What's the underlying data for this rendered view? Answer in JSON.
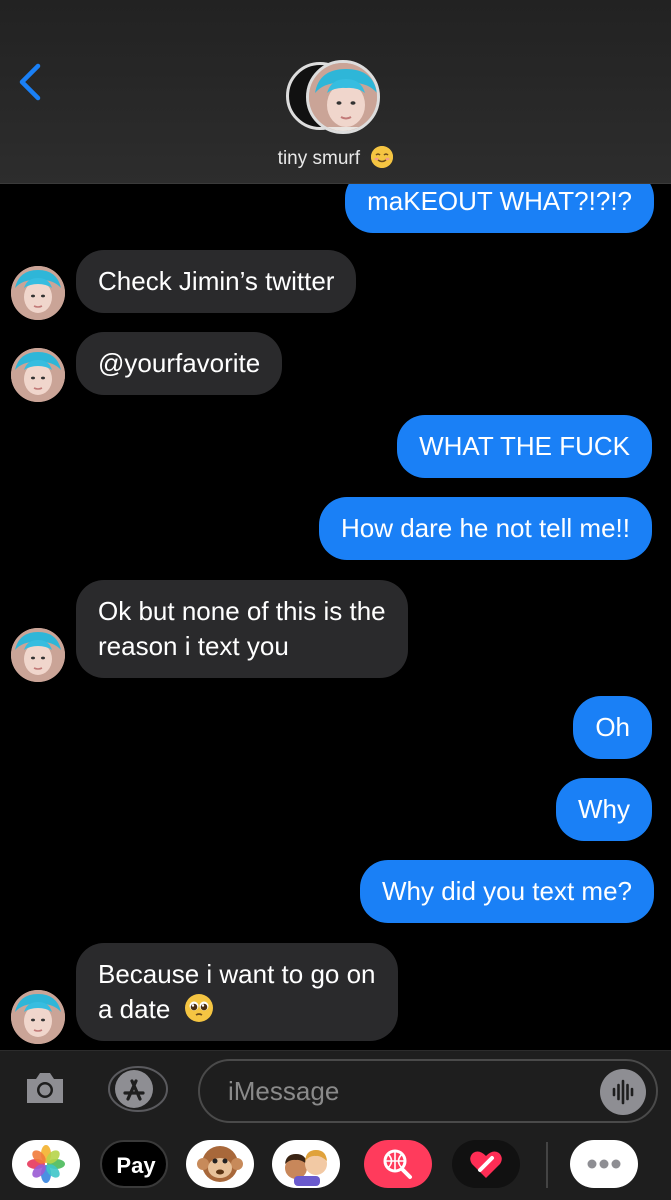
{
  "header": {
    "contact_name": "tiny smurf",
    "contact_emoji": "relieved-face-emoji",
    "back_icon": "chevron-left-icon",
    "accent_color": "#1a80f6"
  },
  "messages": [
    {
      "id": "m1",
      "direction": "out",
      "text": "maKEOUT WHAT?!?!?"
    },
    {
      "id": "m2",
      "direction": "in",
      "text": "Check Jimin’s twitter"
    },
    {
      "id": "m3",
      "direction": "in",
      "text": "@yourfavorite"
    },
    {
      "id": "m4",
      "direction": "out",
      "text": "WHAT THE FUCK"
    },
    {
      "id": "m5",
      "direction": "out",
      "text": "How dare he not tell me!!"
    },
    {
      "id": "m6",
      "direction": "in",
      "line1": "Ok but none of this is the",
      "line2": "reason i text you"
    },
    {
      "id": "m7",
      "direction": "out",
      "text": "Oh"
    },
    {
      "id": "m8",
      "direction": "out",
      "text": "Why"
    },
    {
      "id": "m9",
      "direction": "out",
      "text": "Why did you text me?"
    },
    {
      "id": "m10",
      "direction": "in",
      "line1": "Because i want to go on",
      "line2": "a date",
      "emoji": "pleading-face-emoji"
    }
  ],
  "input": {
    "placeholder": "iMessage",
    "camera_icon": "camera-icon",
    "apps_icon": "app-store-icon",
    "mic_icon": "audio-waveform-icon"
  },
  "app_drawer": {
    "items": [
      {
        "name": "photos-app-icon"
      },
      {
        "name": "apple-pay-icon",
        "label": "Pay"
      },
      {
        "name": "animoji-monkey-icon"
      },
      {
        "name": "memoji-icon"
      },
      {
        "name": "web-search-icon"
      },
      {
        "name": "digital-touch-icon"
      },
      {
        "name": "more-apps-icon"
      }
    ]
  },
  "colors": {
    "outgoing_bubble": "#1a80f6",
    "incoming_bubble": "#2a2a2c",
    "background": "#000000"
  }
}
